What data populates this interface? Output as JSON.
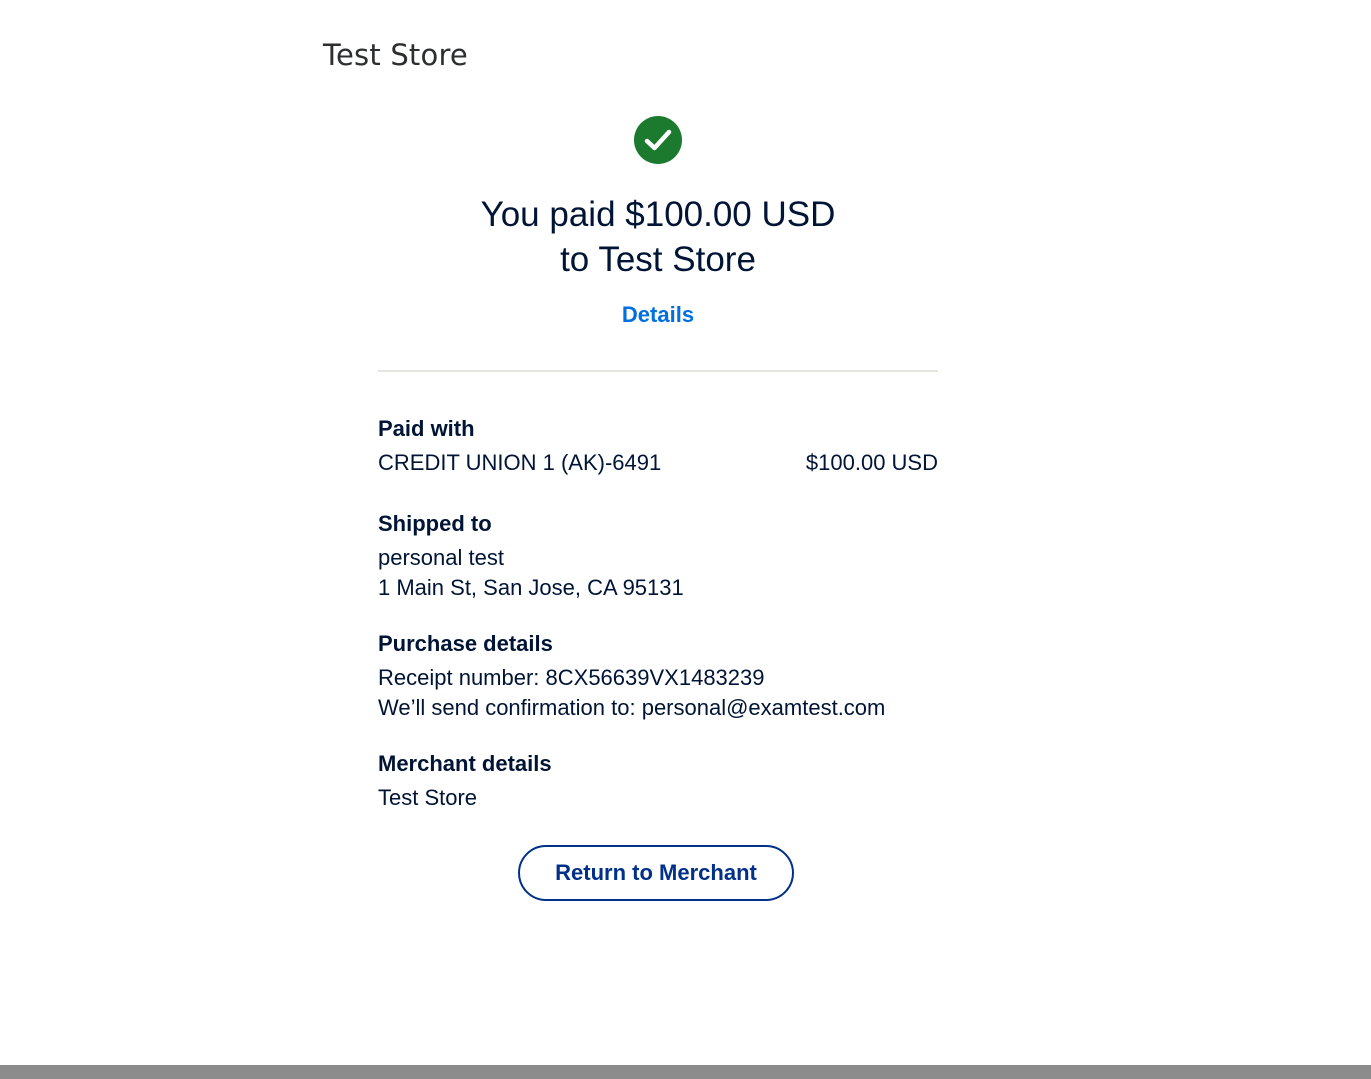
{
  "header": {
    "store_name": "Test Store"
  },
  "status": {
    "icon": "check-circle-icon",
    "color": "#1b7a2e"
  },
  "headline": {
    "line1": "You paid $100.00 USD",
    "line2": "to Test Store"
  },
  "details_link": "Details",
  "paid_with": {
    "title": "Paid with",
    "method": "CREDIT UNION 1 (AK)-6491",
    "amount": "$100.00 USD"
  },
  "shipped_to": {
    "title": "Shipped to",
    "name": "personal test",
    "address": "1 Main St, San Jose, CA 95131"
  },
  "purchase_details": {
    "title": "Purchase details",
    "receipt": "Receipt number: 8CX56639VX1483239",
    "confirmation": "We’ll send confirmation to: personal@examtest.com"
  },
  "merchant_details": {
    "title": "Merchant details",
    "name": "Test Store"
  },
  "actions": {
    "return_label": "Return to Merchant"
  },
  "colors": {
    "link": "#0070e0",
    "button_border": "#003087",
    "text": "#001435"
  }
}
